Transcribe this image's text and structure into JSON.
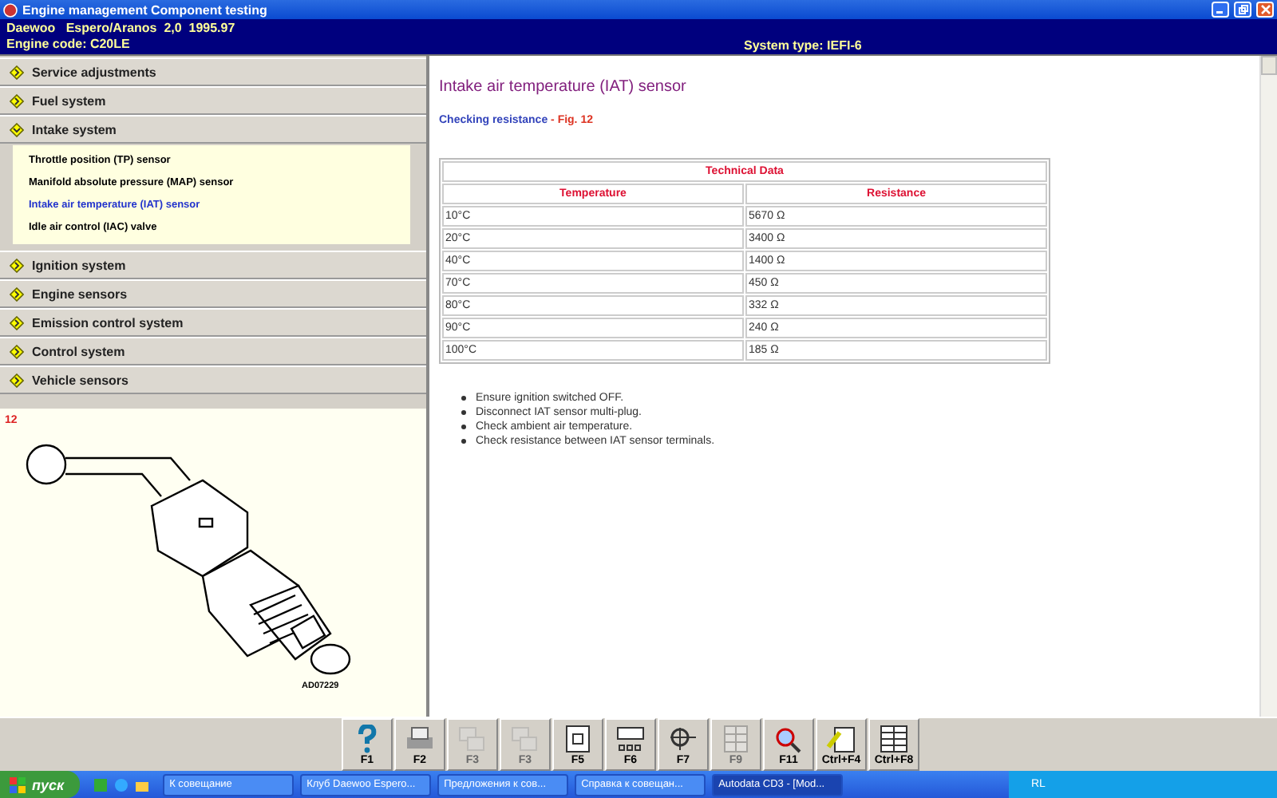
{
  "window": {
    "title": "Engine management Component testing"
  },
  "header": {
    "vehicle": "Daewoo   Espero/Aranos  2,0  1995.97",
    "engine_code": "Engine code: C20LE",
    "system_type": "System type: IEFI-6"
  },
  "sidebar": {
    "sections": [
      {
        "label": "Service adjustments",
        "expanded": false
      },
      {
        "label": "Fuel system",
        "expanded": false
      },
      {
        "label": "Intake system",
        "expanded": true,
        "children": [
          {
            "label": "Throttle position (TP) sensor",
            "selected": false
          },
          {
            "label": "Manifold absolute pressure (MAP) sensor",
            "selected": false
          },
          {
            "label": "Intake air temperature (IAT) sensor",
            "selected": true
          },
          {
            "label": "Idle air control (IAC) valve",
            "selected": false
          }
        ]
      },
      {
        "label": "Ignition system",
        "expanded": false
      },
      {
        "label": "Engine sensors",
        "expanded": false
      },
      {
        "label": "Emission control system",
        "expanded": false
      },
      {
        "label": "Control system",
        "expanded": false
      },
      {
        "label": "Vehicle sensors",
        "expanded": false
      }
    ]
  },
  "figure": {
    "number": "12",
    "code": "AD07229"
  },
  "content": {
    "title": "Intake air temperature (IAT) sensor",
    "subtitle": "Checking resistance",
    "fig_ref": " - Fig. 12",
    "table": {
      "title": "Technical Data",
      "columns": [
        "Temperature",
        "Resistance"
      ],
      "rows": [
        [
          "10°C",
          "5670 Ω"
        ],
        [
          "20°C",
          "3400 Ω"
        ],
        [
          "40°C",
          "1400 Ω"
        ],
        [
          "70°C",
          "450 Ω"
        ],
        [
          "80°C",
          "332 Ω"
        ],
        [
          "90°C",
          "240 Ω"
        ],
        [
          "100°C",
          "185 Ω"
        ]
      ]
    },
    "steps": [
      "Ensure ignition switched OFF.",
      "Disconnect IAT sensor multi-plug.",
      "Check ambient air temperature.",
      "Check resistance between IAT sensor terminals."
    ]
  },
  "toolbar": [
    {
      "kind": "help",
      "label": "F1",
      "disabled": false
    },
    {
      "kind": "print",
      "label": "F2",
      "disabled": false
    },
    {
      "kind": "copy",
      "label": "F3",
      "disabled": true
    },
    {
      "kind": "copy",
      "label": "F3",
      "disabled": true
    },
    {
      "kind": "page",
      "label": "F5",
      "disabled": false
    },
    {
      "kind": "diagram",
      "label": "F6",
      "disabled": false
    },
    {
      "kind": "tool",
      "label": "F7",
      "disabled": false
    },
    {
      "kind": "grid",
      "label": "F9",
      "disabled": true
    },
    {
      "kind": "zoom",
      "label": "F11",
      "disabled": false
    },
    {
      "kind": "note",
      "label": "Ctrl+F4",
      "disabled": false
    },
    {
      "kind": "list",
      "label": "Ctrl+F8",
      "disabled": false
    }
  ],
  "taskbar": {
    "start": "пуск",
    "tasks": [
      {
        "label": "К совещание",
        "selected": false
      },
      {
        "label": "Клуб Daewoo Espero...",
        "selected": false
      },
      {
        "label": "Предложения к сов...",
        "selected": false
      },
      {
        "label": "Справка к совещан...",
        "selected": false
      },
      {
        "label": "Autodata CD3 - [Mod...",
        "selected": true
      }
    ],
    "tray": "RL"
  }
}
